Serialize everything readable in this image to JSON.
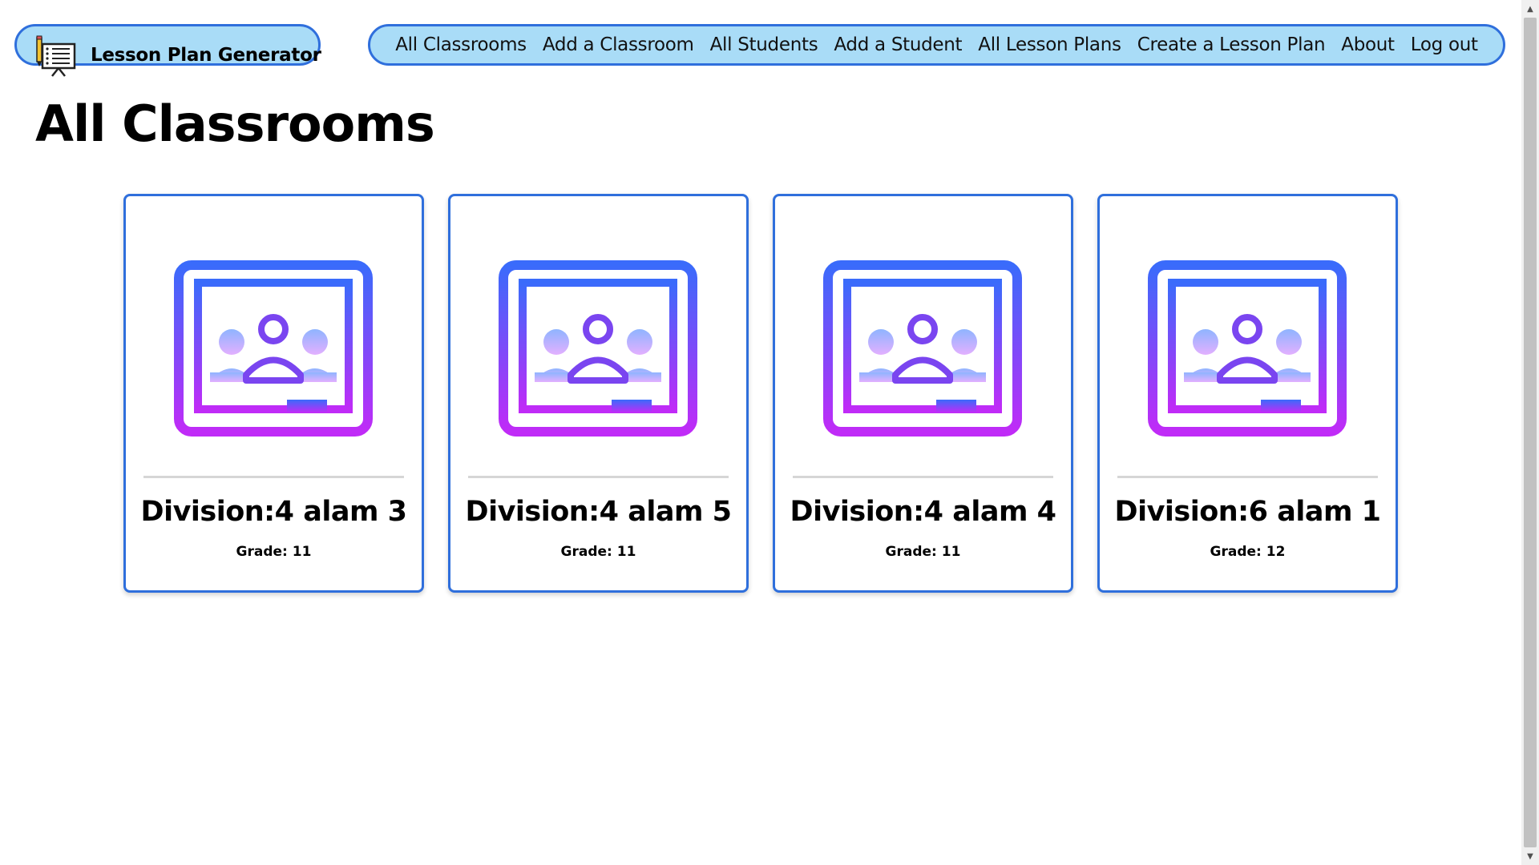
{
  "brand": {
    "name": "Lesson Plan Generator",
    "icon": "lesson-plan-logo-icon"
  },
  "nav": {
    "links": [
      "All Classrooms",
      "Add a Classroom",
      "All Students",
      "Add a Student",
      "All Lesson Plans",
      "Create a Lesson Plan",
      "About",
      "Log out"
    ]
  },
  "page": {
    "title": "All Classrooms"
  },
  "classrooms": [
    {
      "name": "Division:4 alam 3",
      "grade": "Grade: 11",
      "icon": "classroom-icon"
    },
    {
      "name": "Division:4 alam 5",
      "grade": "Grade: 11",
      "icon": "classroom-icon"
    },
    {
      "name": "Division:4 alam 4",
      "grade": "Grade: 11",
      "icon": "classroom-icon"
    },
    {
      "name": "Division:6 alam 1",
      "grade": "Grade: 12",
      "icon": "classroom-icon"
    }
  ],
  "colors": {
    "nav_background": "#a9dcf7",
    "nav_border": "#2f6fdc",
    "card_border": "#2f6fdc",
    "icon_gradient_top": "#3a6bfb",
    "icon_gradient_bottom": "#c02bf7"
  }
}
